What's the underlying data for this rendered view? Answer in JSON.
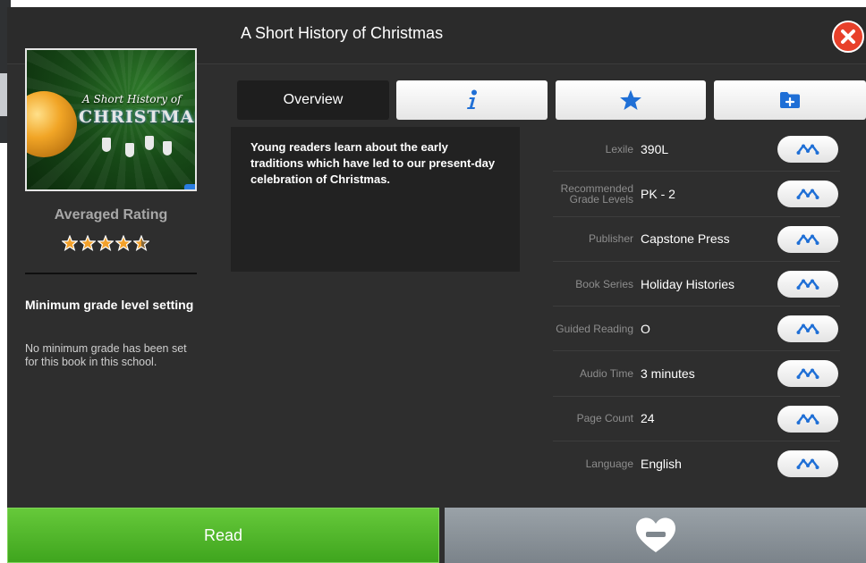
{
  "modal": {
    "title": "A Short History of Christmas"
  },
  "cover": {
    "line1": "A Short History of",
    "line2": "CHRISTMAS"
  },
  "rating": {
    "label": "Averaged Rating",
    "stars": 4.5,
    "max": 5
  },
  "min_grade": {
    "title": "Minimum grade level setting",
    "text": "No minimum grade has been set for this book in this school."
  },
  "tabs": [
    {
      "label": "Overview",
      "icon": "",
      "selected": true
    },
    {
      "label": "",
      "icon": "info-icon",
      "selected": false
    },
    {
      "label": "",
      "icon": "star-icon",
      "selected": false
    },
    {
      "label": "",
      "icon": "folder-add-icon",
      "selected": false
    }
  ],
  "overview": {
    "text": "Young readers learn about the early traditions which have led to our present-day celebration of Christmas."
  },
  "details": [
    {
      "label": "Lexile",
      "value": "390L",
      "icon": "related-books-icon"
    },
    {
      "label": "Recommended Grade Levels",
      "value": "PK - 2",
      "icon": "related-books-icon"
    },
    {
      "label": "Publisher",
      "value": "Capstone Press",
      "icon": "related-books-icon"
    },
    {
      "label": "Book Series",
      "value": "Holiday Histories",
      "icon": "related-books-icon"
    },
    {
      "label": "Guided Reading",
      "value": "O",
      "icon": "related-books-icon"
    },
    {
      "label": "Audio Time",
      "value": "3 minutes",
      "icon": "related-books-icon"
    },
    {
      "label": "Page Count",
      "value": "24",
      "icon": "related-books-icon"
    },
    {
      "label": "Language",
      "value": "English",
      "icon": "related-books-icon"
    }
  ],
  "actions": {
    "read_label": "Read",
    "favorite_icon": "heart-minus-icon"
  },
  "colors": {
    "accent_blue": "#1f6fd6",
    "read_green": "#4db52a",
    "close_red": "#e8402a",
    "star_orange": "#f3a12b"
  }
}
